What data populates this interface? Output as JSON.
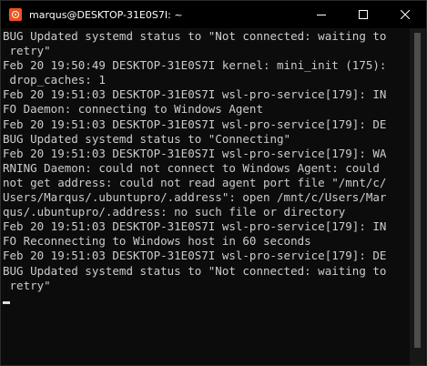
{
  "window": {
    "title": "marqus@DESKTOP-31E0S7I: ~",
    "app_icon": "ubuntu-icon",
    "controls": [
      "minimize-icon",
      "maximize-icon",
      "close-icon"
    ]
  },
  "terminal": {
    "lines": [
      "BUG Updated systemd status to \"Not connected: waiting to",
      " retry\"",
      "Feb 20 19:50:49 DESKTOP-31E0S7I kernel: mini_init (175):",
      " drop_caches: 1",
      "Feb 20 19:51:03 DESKTOP-31E0S7I wsl-pro-service[179]: IN",
      "FO Daemon: connecting to Windows Agent",
      "Feb 20 19:51:03 DESKTOP-31E0S7I wsl-pro-service[179]: DE",
      "BUG Updated systemd status to \"Connecting\"",
      "Feb 20 19:51:03 DESKTOP-31E0S7I wsl-pro-service[179]: WA",
      "RNING Daemon: could not connect to Windows Agent: could",
      "not get address: could not read agent port file \"/mnt/c/",
      "Users/Marqus/.ubuntupro/.address\": open /mnt/c/Users/Mar",
      "qus/.ubuntupro/.address: no such file or directory",
      "Feb 20 19:51:03 DESKTOP-31E0S7I wsl-pro-service[179]: IN",
      "FO Reconnecting to Windows host in 60 seconds",
      "Feb 20 19:51:03 DESKTOP-31E0S7I wsl-pro-service[179]: DE",
      "BUG Updated systemd status to \"Not connected: waiting to",
      " retry\""
    ]
  },
  "scrollbar": {
    "thumb_fraction": 0.96
  },
  "colors": {
    "background": "#0c0c0c",
    "titlebar": "#000000",
    "text": "#cccccc",
    "title_text": "#ffffff",
    "accent": "#e95420"
  }
}
